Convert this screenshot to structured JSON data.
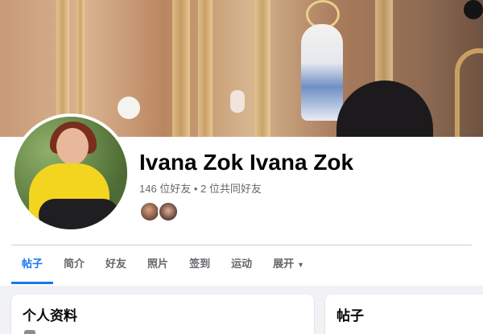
{
  "profile": {
    "name": "Ivana Zok Ivana Zok",
    "friends_text": "146 位好友 • 2 位共同好友"
  },
  "tabs": [
    {
      "label": "帖子",
      "active": true
    },
    {
      "label": "简介",
      "active": false
    },
    {
      "label": "好友",
      "active": false
    },
    {
      "label": "照片",
      "active": false
    },
    {
      "label": "签到",
      "active": false
    },
    {
      "label": "运动",
      "active": false
    },
    {
      "label": "展开",
      "active": false,
      "icon": "caret-down-icon"
    }
  ],
  "cards": {
    "left_title": "个人资料",
    "right_title": "帖子"
  },
  "colors": {
    "accent": "#1877f2",
    "text": "#050505",
    "muted": "#65676b",
    "page_bg": "#f0f2f5"
  }
}
